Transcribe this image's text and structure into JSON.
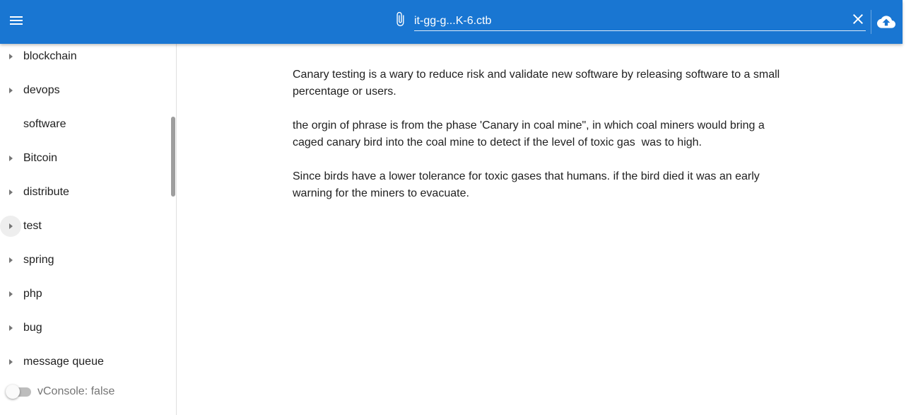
{
  "header": {
    "menu_icon": "menu-icon",
    "attach_icon": "paperclip-icon",
    "file_name": "it-gg-g...K-6.ctb",
    "clear_icon": "close-icon",
    "upload_icon": "cloud-upload-icon",
    "background_color": "#1976d2"
  },
  "sidebar": {
    "items": [
      {
        "label": "blockchain",
        "has_children": true
      },
      {
        "label": "devops",
        "has_children": true
      },
      {
        "label": "software",
        "has_children": false
      },
      {
        "label": "Bitcoin",
        "has_children": true
      },
      {
        "label": "distribute",
        "has_children": true
      },
      {
        "label": "test",
        "has_children": true,
        "hovered": true
      },
      {
        "label": "spring",
        "has_children": true
      },
      {
        "label": "php",
        "has_children": true
      },
      {
        "label": "bug",
        "has_children": true
      },
      {
        "label": "message queue",
        "has_children": true
      }
    ],
    "vconsole": {
      "label": "vConsole: false",
      "enabled": false
    }
  },
  "main": {
    "paragraphs": [
      "Canary testing is a wary to reduce risk and validate new software by releasing software to a small percentage or users.",
      "the orgin of phrase is from the phase 'Canary in coal mine\", in which coal miners would bring a caged canary bird into the coal mine to detect if the level of toxic gas  was to high.",
      "Since birds have a lower tolerance for toxic gases that humans. if the bird died it was an early warning for the miners to evacuate."
    ]
  }
}
